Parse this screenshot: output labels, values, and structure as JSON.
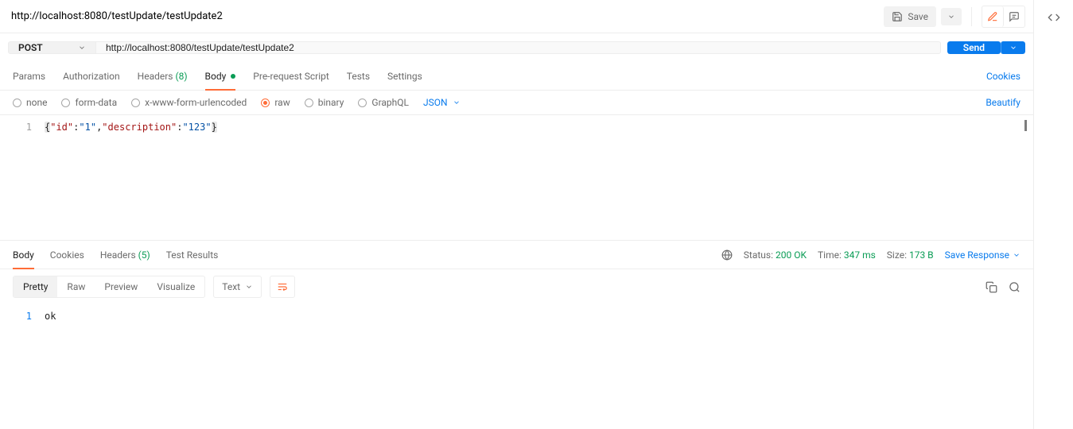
{
  "header": {
    "title": "http://localhost:8080/testUpdate/testUpdate2",
    "save_label": "Save"
  },
  "request": {
    "method": "POST",
    "url": "http://localhost:8080/testUpdate/testUpdate2",
    "send_label": "Send"
  },
  "tabs": {
    "params": "Params",
    "authorization": "Authorization",
    "headers": "Headers",
    "headers_count": "(8)",
    "body": "Body",
    "prerequest": "Pre-request Script",
    "tests": "Tests",
    "settings": "Settings",
    "cookies": "Cookies"
  },
  "body_types": {
    "none": "none",
    "formdata": "form-data",
    "xform": "x-www-form-urlencoded",
    "raw": "raw",
    "binary": "binary",
    "graphql": "GraphQL",
    "format": "JSON",
    "beautify": "Beautify"
  },
  "editor": {
    "line_no": "1",
    "line1": {
      "open": "{",
      "k1": "\"id\"",
      "c1": ":",
      "v1": "\"1\"",
      "comma": ",",
      "k2": "\"description\"",
      "c2": ":",
      "v2": "\"123\"",
      "close": "}"
    }
  },
  "response": {
    "tabs": {
      "body": "Body",
      "cookies": "Cookies",
      "headers": "Headers",
      "headers_count": "(5)",
      "testresults": "Test Results"
    },
    "status_label": "Status:",
    "status_value": "200 OK",
    "time_label": "Time:",
    "time_value": "347 ms",
    "size_label": "Size:",
    "size_value": "173 B",
    "save_response": "Save Response",
    "views": {
      "pretty": "Pretty",
      "raw": "Raw",
      "preview": "Preview",
      "visualize": "Visualize",
      "text": "Text"
    },
    "body_line_no": "1",
    "body_text": "ok"
  }
}
